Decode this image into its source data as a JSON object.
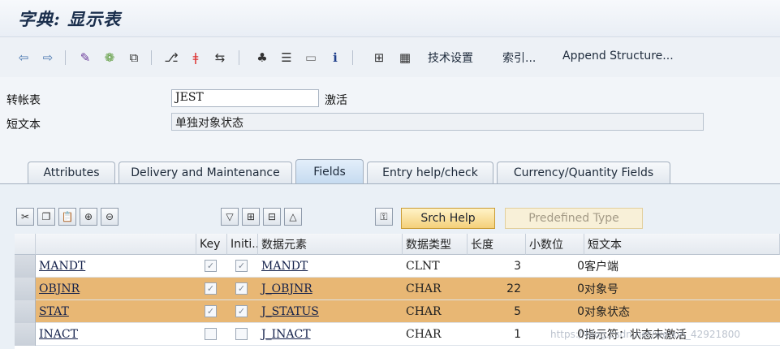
{
  "title": "字典: 显示表",
  "toolbar": {
    "tech_settings": "技术设置",
    "index": "索引...",
    "append_structure": "Append Structure..."
  },
  "form": {
    "table_label": "转帐表",
    "table_value": "JEST",
    "status": "激活",
    "short_text_label": "短文本",
    "short_text_value": "单独对象状态"
  },
  "tabs": [
    {
      "label": "Attributes"
    },
    {
      "label": "Delivery and Maintenance"
    },
    {
      "label": "Fields",
      "active": true
    },
    {
      "label": "Entry help/check"
    },
    {
      "label": "Currency/Quantity Fields"
    }
  ],
  "buttons": {
    "srch_help": "Srch Help",
    "predefined_type": "Predefined Type"
  },
  "columns": {
    "key": "Key",
    "initial": "Initi...",
    "data_element": "数据元素",
    "data_type": "数据类型",
    "length": "长度",
    "decimals": "小数位",
    "short_text": "短文本"
  },
  "rows": [
    {
      "field": "MANDT",
      "key": true,
      "initial": true,
      "data_element": "MANDT",
      "data_type": "CLNT",
      "length": "3",
      "decimals": "0",
      "short_text": "客户端",
      "selected": false
    },
    {
      "field": "OBJNR",
      "key": true,
      "initial": true,
      "data_element": "J_OBJNR",
      "data_type": "CHAR",
      "length": "22",
      "decimals": "0",
      "short_text": "对象号",
      "selected": true
    },
    {
      "field": "STAT",
      "key": true,
      "initial": true,
      "data_element": "J_STATUS",
      "data_type": "CHAR",
      "length": "5",
      "decimals": "0",
      "short_text": "对象状态",
      "selected": true
    },
    {
      "field": "INACT",
      "key": false,
      "initial": false,
      "data_element": "J_INACT",
      "data_type": "CHAR",
      "length": "1",
      "decimals": "0",
      "short_text": "指示符：状态未激活",
      "selected": false
    }
  ],
  "watermark": "https://blog.csdn.net/weixin_42921800",
  "colors": {
    "selected_row": "#e8b774",
    "srch_button": "#f4d07a"
  }
}
